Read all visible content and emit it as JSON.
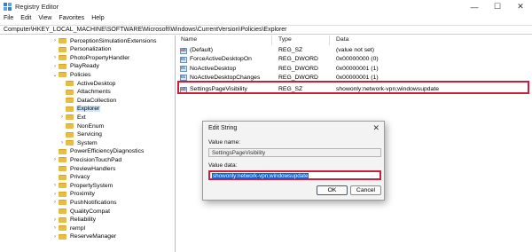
{
  "window": {
    "title": "Registry Editor",
    "minimize": "—",
    "maximize": "☐",
    "close": "✕"
  },
  "menu": [
    "File",
    "Edit",
    "View",
    "Favorites",
    "Help"
  ],
  "address": "Computer\\HKEY_LOCAL_MACHINE\\SOFTWARE\\Microsoft\\Windows\\CurrentVersion\\Policies\\Explorer",
  "tree": {
    "items": [
      {
        "label": "PerceptionSimulationExtensions",
        "expander": "›"
      },
      {
        "label": "Personalization",
        "expander": ""
      },
      {
        "label": "PhotoPropertyHandler",
        "expander": "›"
      },
      {
        "label": "PlayReady",
        "expander": "›"
      },
      {
        "label": "Policies",
        "expander": "⌄"
      },
      {
        "label": "ActiveDesktop",
        "expander": ""
      },
      {
        "label": "Attachments",
        "expander": ""
      },
      {
        "label": "DataCollection",
        "expander": ""
      },
      {
        "label": "Explorer",
        "expander": ""
      },
      {
        "label": "Ext",
        "expander": "›"
      },
      {
        "label": "NonEnum",
        "expander": ""
      },
      {
        "label": "Servicing",
        "expander": ""
      },
      {
        "label": "System",
        "expander": "›"
      },
      {
        "label": "PowerEfficiencyDiagnostics",
        "expander": ""
      },
      {
        "label": "PrecisionTouchPad",
        "expander": "›"
      },
      {
        "label": "PreviewHandlers",
        "expander": ""
      },
      {
        "label": "Privacy",
        "expander": ""
      },
      {
        "label": "PropertySystem",
        "expander": "›"
      },
      {
        "label": "Proximity",
        "expander": "›"
      },
      {
        "label": "PushNotifications",
        "expander": "›"
      },
      {
        "label": "QualityCompat",
        "expander": ""
      },
      {
        "label": "Reliability",
        "expander": "›"
      },
      {
        "label": "rempl",
        "expander": "›"
      },
      {
        "label": "ReserveManager",
        "expander": "›"
      }
    ]
  },
  "list": {
    "headers": {
      "name": "Name",
      "type": "Type",
      "data": "Data"
    },
    "rows": [
      {
        "name": "(Default)",
        "type": "REG_SZ",
        "data": "(value not set)",
        "icon": "sz"
      },
      {
        "name": "ForceActiveDesktopOn",
        "type": "REG_DWORD",
        "data": "0x00000000 (0)",
        "icon": "dw"
      },
      {
        "name": "NoActiveDesktop",
        "type": "REG_DWORD",
        "data": "0x00000001 (1)",
        "icon": "dw"
      },
      {
        "name": "NoActiveDesktopChanges",
        "type": "REG_DWORD",
        "data": "0x00000001 (1)",
        "icon": "dw"
      },
      {
        "name": "SettingsPageVisibility",
        "type": "REG_SZ",
        "data": "showonly:network-vpn;windowsupdate",
        "icon": "sz"
      }
    ]
  },
  "dialog": {
    "title": "Edit String",
    "close": "✕",
    "value_name_label": "Value name:",
    "value_name": "SettingsPageVisibility",
    "value_data_label": "Value data:",
    "value_data": "showonly:network-vpn;windowsupdate",
    "ok": "OK",
    "cancel": "Cancel"
  }
}
